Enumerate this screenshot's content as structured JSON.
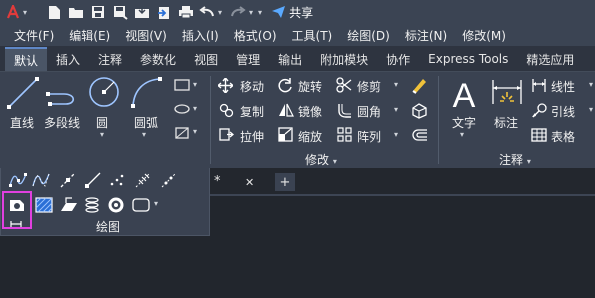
{
  "quick_access": {
    "app_icon": "autocad-logo-icon",
    "share_label": "共享",
    "icons": [
      "new-icon",
      "open-icon",
      "save-icon",
      "save-as-icon",
      "cloud-open-icon",
      "cloud-save-icon",
      "print-icon",
      "undo-icon",
      "redo-icon",
      "share-icon"
    ]
  },
  "menu": {
    "items": [
      "文件(F)",
      "编辑(E)",
      "视图(V)",
      "插入(I)",
      "格式(O)",
      "工具(T)",
      "绘图(D)",
      "标注(N)",
      "修改(M)"
    ]
  },
  "ribbon_tabs": [
    "默认",
    "插入",
    "注释",
    "参数化",
    "视图",
    "管理",
    "输出",
    "附加模块",
    "协作",
    "Express Tools",
    "精选应用"
  ],
  "active_tab": "默认",
  "draw_panel": {
    "title": "绘图",
    "line": "直线",
    "polyline": "多段线",
    "circle": "圆",
    "arc": "圆弧"
  },
  "modify_panel": {
    "title": "修改",
    "move": "移动",
    "rotate": "旋转",
    "trim": "修剪",
    "copy": "复制",
    "mirror": "镜像",
    "fillet": "圆角",
    "stretch": "拉伸",
    "scale": "缩放",
    "array": "阵列"
  },
  "annotation_panel": {
    "title": "注释",
    "text": "文字",
    "dimension": "标注",
    "linear": "线性",
    "leader": "引线",
    "table": "表格"
  },
  "document_tabs": {
    "unsaved_marker": "*",
    "close": "✕",
    "new": "+"
  },
  "colors": {
    "highlight": "#e040e0",
    "accent": "#5f87c6"
  }
}
